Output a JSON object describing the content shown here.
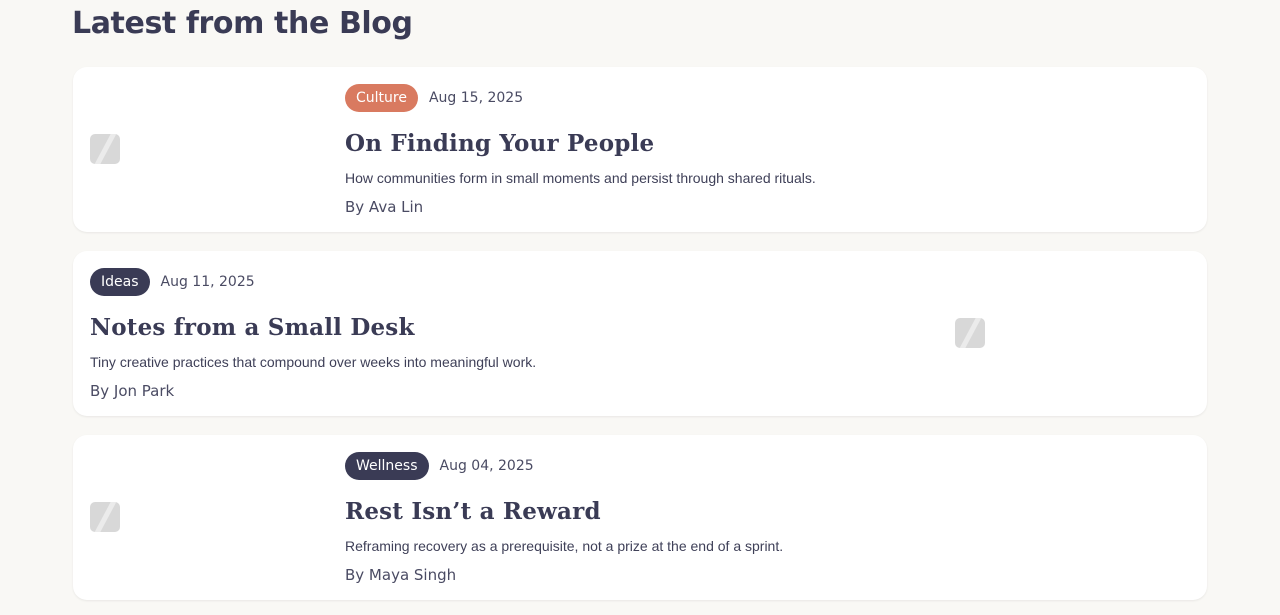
{
  "page": {
    "title": "Latest from the Blog"
  },
  "colors": {
    "background": "#f9f8f5",
    "card": "#ffffff",
    "text": "#3a3b55",
    "tag_culture": "#d97a60",
    "tag_ideas": "#3a3b55",
    "tag_wellness": "#3a3b55"
  },
  "posts": [
    {
      "tag": "Culture",
      "tag_color": "#d97a60",
      "date": "Aug 15, 2025",
      "title": "On Finding Your People",
      "summary": "How communities form in small moments and persist through shared rituals.",
      "author": "By Ava Lin",
      "image_icon": "image-placeholder-icon"
    },
    {
      "tag": "Ideas",
      "tag_color": "#3a3b55",
      "date": "Aug 11, 2025",
      "title": "Notes from a Small Desk",
      "summary": "Tiny creative practices that compound over weeks into meaningful work.",
      "author": "By Jon Park",
      "image_icon": "image-placeholder-icon"
    },
    {
      "tag": "Wellness",
      "tag_color": "#3a3b55",
      "date": "Aug 04, 2025",
      "title": "Rest Isn’t a Reward",
      "summary": "Reframing recovery as a prerequisite, not a prize at the end of a sprint.",
      "author": "By Maya Singh",
      "image_icon": "image-placeholder-icon"
    }
  ]
}
